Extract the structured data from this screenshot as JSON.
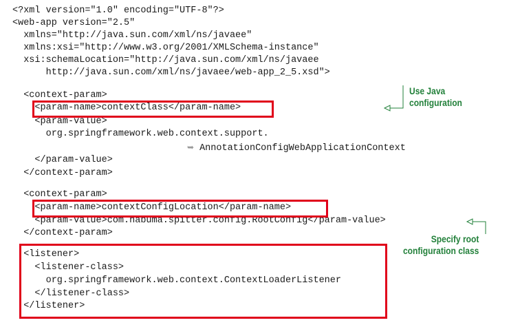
{
  "code_lines": [
    "<?xml version=\"1.0\" encoding=\"UTF-8\"?>",
    "<web-app version=\"2.5\"",
    "  xmlns=\"http://java.sun.com/xml/ns/javaee\"",
    "  xmlns:xsi=\"http://www.w3.org/2001/XMLSchema-instance\"",
    "  xsi:schemaLocation=\"http://java.sun.com/xml/ns/javaee",
    "      http://java.sun.com/xml/ns/javaee/web-app_2_5.xsd\">",
    "  <context-param>",
    "    <param-name>contextClass</param-name>",
    "    <param-value>",
    "      org.springframework.web.context.support.",
    "AnnotationConfigWebApplicationContext",
    "    </param-value>",
    "  </context-param>",
    "  <context-param>",
    "    <param-name>contextConfigLocation</param-name>",
    "    <param-value>com.habuma.spitter.config.RootConfig</param-value>",
    "  </context-param>",
    "  <listener>",
    "    <listener-class>",
    "      org.springframework.web.context.ContextLoaderListener",
    "    </listener-class>",
    "  </listener>"
  ],
  "continuation_marker": "➥",
  "annotations": {
    "java_config": [
      "Use Java",
      "configuration"
    ],
    "root_config": [
      "Specify root",
      "configuration class"
    ]
  },
  "colors": {
    "highlight_box": "#e0001a",
    "annotation_text": "#22803a",
    "callout_line": "#22803a",
    "code_text": "#1a1a1a"
  }
}
